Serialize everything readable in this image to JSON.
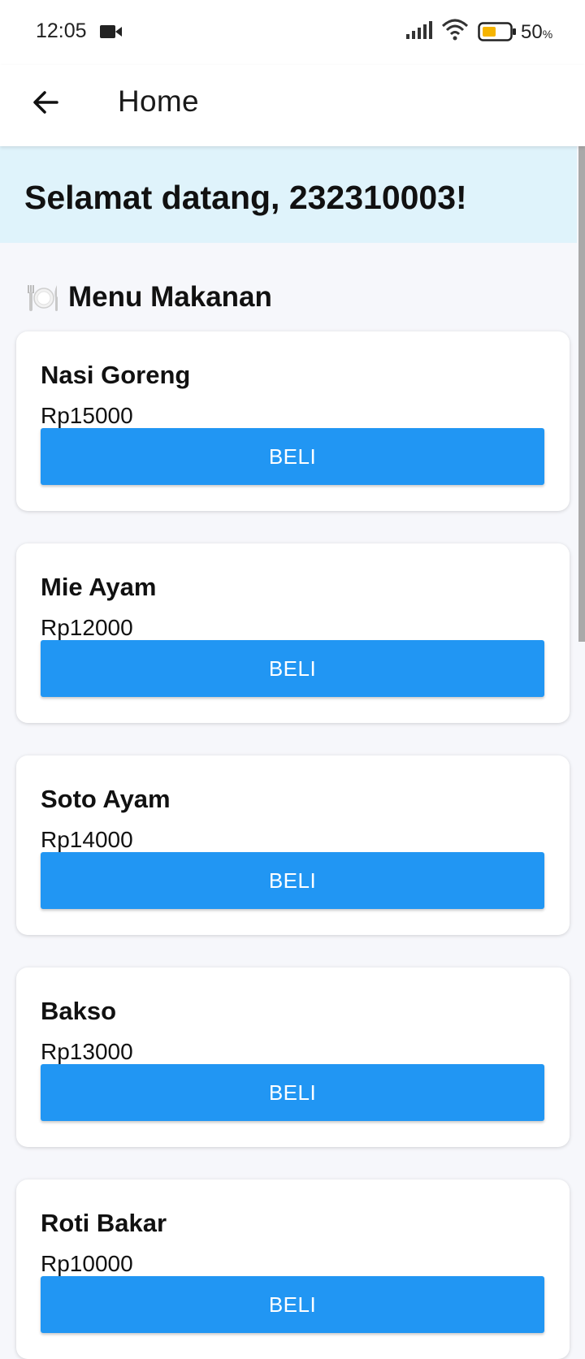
{
  "status_bar": {
    "time": "12:05",
    "battery_percent": "50",
    "battery_symbol": "%",
    "battery_level": 0.5,
    "battery_color": "#f5b400"
  },
  "app_bar": {
    "title": "Home",
    "back_icon": "arrow-left-icon"
  },
  "welcome": {
    "text": "Selamat datang, 232310003!",
    "background": "#dff3fb"
  },
  "menu": {
    "heading_icon": "🍽️",
    "heading": "Menu Makanan",
    "accent_color": "#2196f3",
    "items": [
      {
        "name": "Nasi Goreng",
        "price": "Rp15000",
        "button": "BELI"
      },
      {
        "name": "Mie Ayam",
        "price": "Rp12000",
        "button": "BELI"
      },
      {
        "name": "Soto Ayam",
        "price": "Rp14000",
        "button": "BELI"
      },
      {
        "name": "Bakso",
        "price": "Rp13000",
        "button": "BELI"
      },
      {
        "name": "Roti Bakar",
        "price": "Rp10000",
        "button": "BELI"
      }
    ]
  }
}
